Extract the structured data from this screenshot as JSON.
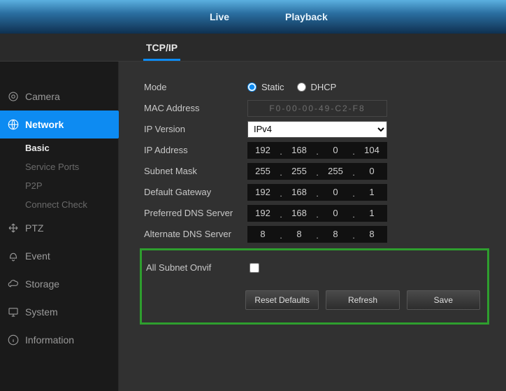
{
  "topbar": {
    "live": "Live",
    "playback": "Playback"
  },
  "subtabs": {
    "tcpip": "TCP/IP"
  },
  "sidebar": {
    "camera": "Camera",
    "network": "Network",
    "network_sub": {
      "basic": "Basic",
      "service_ports": "Service Ports",
      "p2p": "P2P",
      "connect_check": "Connect Check"
    },
    "ptz": "PTZ",
    "event": "Event",
    "storage": "Storage",
    "system": "System",
    "information": "Information"
  },
  "labels": {
    "mode": "Mode",
    "mac": "MAC Address",
    "ipver": "IP Version",
    "ip": "IP Address",
    "subnet": "Subnet Mask",
    "gateway": "Default Gateway",
    "pdns": "Preferred DNS Server",
    "adns": "Alternate DNS Server",
    "all_onvif": "All Subnet Onvif"
  },
  "mode": {
    "static": "Static",
    "dhcp": "DHCP",
    "selected": "static"
  },
  "mac_value": "F0-00-00-49-C2-F8",
  "ipver_value": "IPv4",
  "ip": {
    "a": "192",
    "b": "168",
    "c": "0",
    "d": "104"
  },
  "subnet": {
    "a": "255",
    "b": "255",
    "c": "255",
    "d": "0"
  },
  "gateway": {
    "a": "192",
    "b": "168",
    "c": "0",
    "d": "1"
  },
  "pdns": {
    "a": "192",
    "b": "168",
    "c": "0",
    "d": "1"
  },
  "adns": {
    "a": "8",
    "b": "8",
    "c": "8",
    "d": "8"
  },
  "all_onvif_checked": false,
  "buttons": {
    "reset": "Reset Defaults",
    "refresh": "Refresh",
    "save": "Save"
  }
}
